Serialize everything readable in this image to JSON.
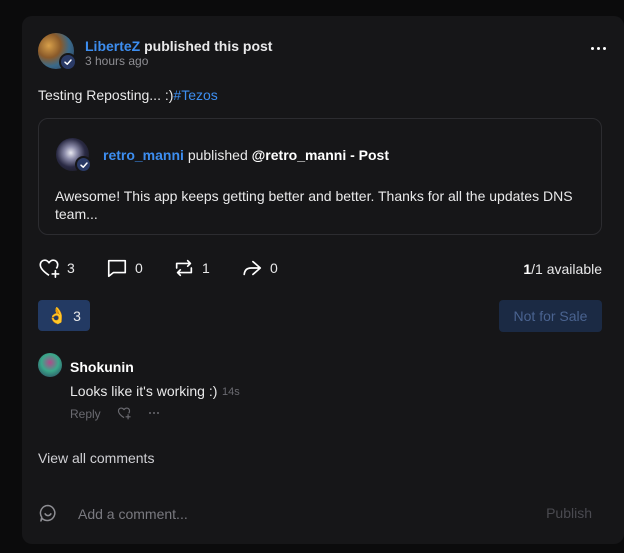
{
  "post": {
    "author": "LiberteZ",
    "action": "published this post",
    "time": "3 hours ago",
    "text": "Testing Reposting... :)",
    "hashtag": "#Tezos"
  },
  "quote": {
    "author": "retro_manni",
    "action": "published",
    "reference": "@retro_manni - Post",
    "text": "Awesome! This app keeps getting better and better. Thanks for all the updates DNS team..."
  },
  "actions": {
    "likes": "3",
    "comments": "0",
    "reposts": "1",
    "shares": "0",
    "available_count": "1",
    "available_rest": "/1 available"
  },
  "reaction": {
    "emoji": "👌",
    "count": "3"
  },
  "sale": {
    "label": "Not for Sale"
  },
  "comment": {
    "author": "Shokunin",
    "text": "Looks like it's working :)",
    "time": "14s",
    "reply": "Reply"
  },
  "view_all": "View all comments",
  "composer": {
    "placeholder": "Add a comment...",
    "publish": "Publish"
  },
  "colors": {
    "accent": "#3d8ef0",
    "background": "#161618",
    "reaction_bg": "#233a63"
  }
}
